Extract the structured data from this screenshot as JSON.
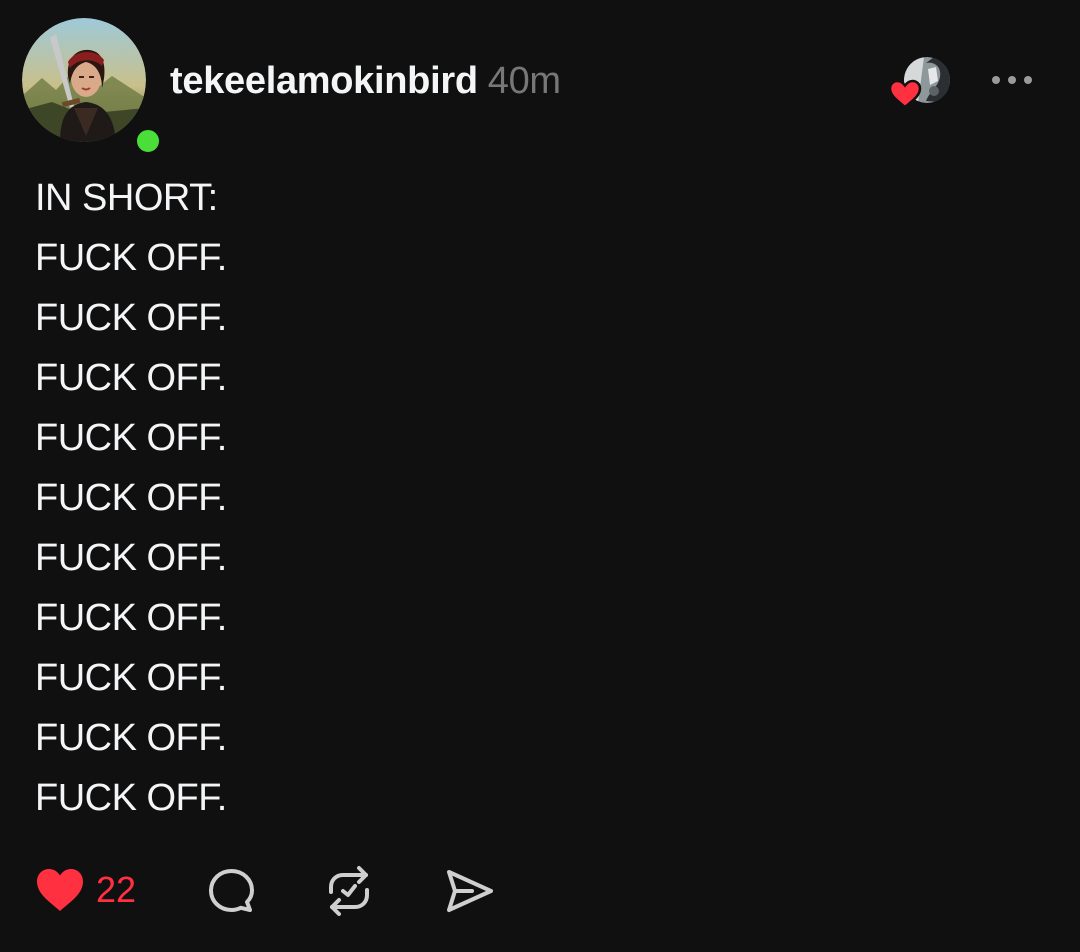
{
  "post": {
    "author": {
      "username": "tekeelamokinbird",
      "avatar_icon": "profile-avatar",
      "online": true,
      "online_color": "#4ade38"
    },
    "timestamp": "40m",
    "liked_by_icon": "liker-avatar",
    "more_icon": "more-horizontal-icon",
    "text_lines": [
      "IN SHORT:",
      "FUCK OFF.",
      "FUCK OFF.",
      "FUCK OFF.",
      "FUCK OFF.",
      "FUCK OFF.",
      "FUCK OFF.",
      "FUCK OFF.",
      "FUCK OFF.",
      "FUCK OFF.",
      "FUCK OFF."
    ],
    "actions": {
      "like": {
        "icon": "heart-icon",
        "count": "22",
        "liked": true,
        "color": "#ff3040"
      },
      "reply": {
        "icon": "comment-icon"
      },
      "repost": {
        "icon": "repost-icon"
      },
      "share": {
        "icon": "send-icon"
      }
    }
  },
  "theme": {
    "background": "#101010",
    "text": "#f3f5f7",
    "muted": "#777777",
    "accent": "#ff3040"
  }
}
